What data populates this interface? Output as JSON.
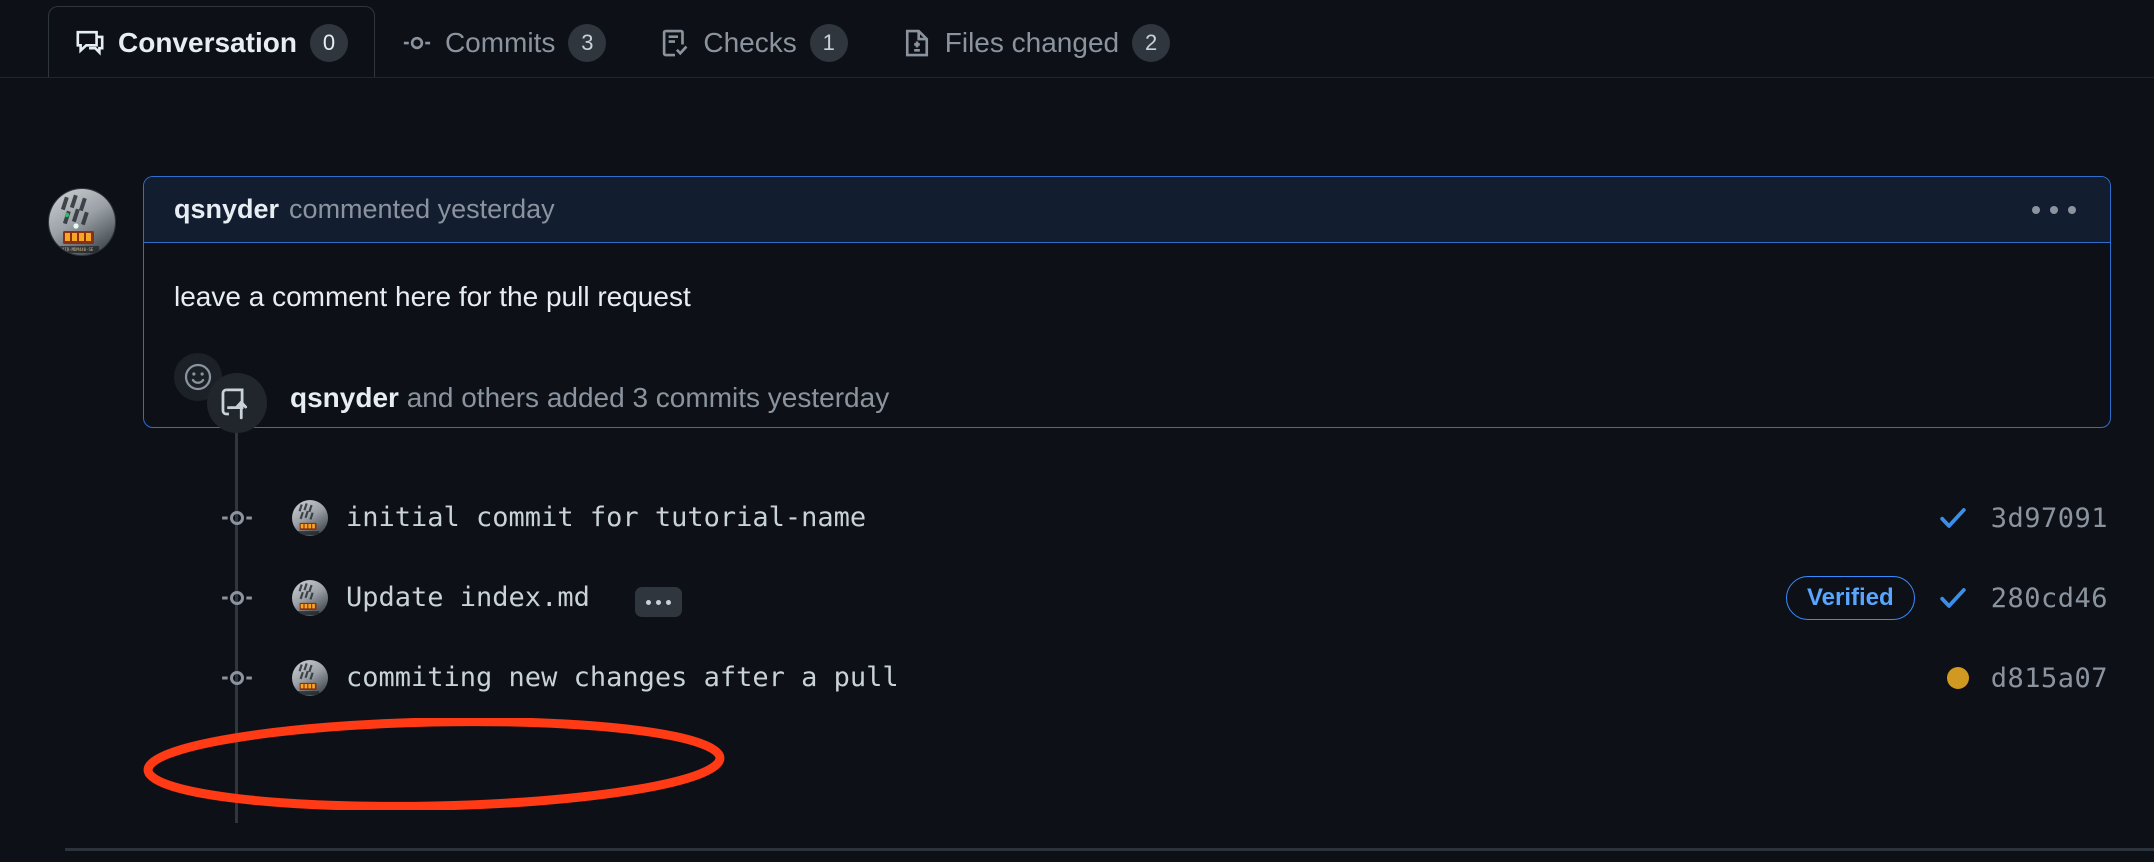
{
  "tabs": [
    {
      "id": "conversation",
      "label": "Conversation",
      "count": "0",
      "icon": "comment-discussion-icon",
      "selected": true
    },
    {
      "id": "commits",
      "label": "Commits",
      "count": "3",
      "icon": "git-commit-icon",
      "selected": false
    },
    {
      "id": "checks",
      "label": "Checks",
      "count": "1",
      "icon": "checklist-icon",
      "selected": false
    },
    {
      "id": "files",
      "label": "Files changed",
      "count": "2",
      "icon": "file-diff-icon",
      "selected": false
    }
  ],
  "comment": {
    "author": "qsnyder",
    "meta": "commented yesterday",
    "body": "leave a comment here for the pull request",
    "reaction_icon": "smiley-icon",
    "menu_icon": "kebab-horizontal-icon",
    "avatar_icon": "user-avatar"
  },
  "push_event": {
    "icon": "repo-push-icon",
    "author": "qsnyder",
    "text": "and others added 3 commits yesterday"
  },
  "commits": [
    {
      "message": "initial commit for tutorial-name",
      "sha": "3d97091",
      "status": "success",
      "status_icon": "check-icon",
      "verified": false,
      "has_expander": false
    },
    {
      "message": "Update index.md",
      "sha": "280cd46",
      "status": "success",
      "status_icon": "check-icon",
      "verified": true,
      "verified_label": "Verified",
      "has_expander": true,
      "expander_icon": "kebab-horizontal-icon"
    },
    {
      "message": "commiting new changes after a pull",
      "sha": "d815a07",
      "status": "pending",
      "status_icon": "dot-fill-icon",
      "verified": false,
      "has_expander": false
    }
  ],
  "annotation": {
    "shape": "ellipse",
    "color": "#FF3A14",
    "target": "commiting new changes after a pull"
  },
  "colors": {
    "background": "#0d1117",
    "accent_blue": "#58a6ff",
    "comment_border": "#316dca",
    "comment_header_bg": "#121d2f",
    "pending_yellow": "#d29922",
    "annotation_red": "#FF3A14"
  }
}
